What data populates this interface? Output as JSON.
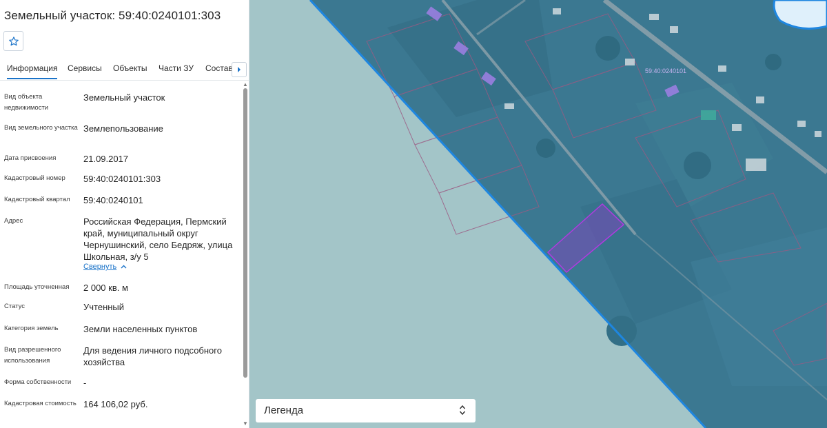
{
  "panel": {
    "title": "Земельный участок: 59:40:0240101:303",
    "favorite_icon": "star-outline-icon",
    "tabs": [
      {
        "label": "Информация",
        "active": true
      },
      {
        "label": "Сервисы",
        "active": false
      },
      {
        "label": "Объекты",
        "active": false
      },
      {
        "label": "Части ЗУ",
        "active": false
      },
      {
        "label": "Состав",
        "active": false
      }
    ],
    "tab_scroll_icon": "caret-right-icon",
    "fields": [
      {
        "label": "Вид объекта недвижимости",
        "value": "Земельный участок"
      },
      {
        "label": "Вид земельного участка",
        "value": "Землепользование"
      },
      {
        "label": "Дата присвоения",
        "value": "21.09.2017"
      },
      {
        "label": "Кадастровый номер",
        "value": "59:40:0240101:303"
      },
      {
        "label": "Кадастровый квартал",
        "value": "59:40:0240101"
      },
      {
        "label": "Адрес",
        "value": "Российская Федерация, Пермский край, муниципальный округ Чернушинский, село Бедряж, улица Школьная, з/у 5"
      },
      {
        "label": "Площадь уточненная",
        "value": "2 000 кв. м"
      },
      {
        "label": "Статус",
        "value": "Учтенный"
      },
      {
        "label": "Категория земель",
        "value": "Земли населенных пунктов"
      },
      {
        "label": "Вид разрешенного использования",
        "value": "Для ведения личного подсобного хозяйства"
      },
      {
        "label": "Форма собственности",
        "value": "-"
      },
      {
        "label": "Кадастровая стоимость",
        "value": "164 106,02 руб."
      }
    ],
    "collapse_link": "Свернуть"
  },
  "map": {
    "quarter_label": "59:40:0240101",
    "legend_label": "Легенда",
    "legend_toggle_icon": "up-down-chevron-icon",
    "colors": {
      "outside_area": "#a3c5c8",
      "imagery": "#3b7891",
      "boundary": "#1e86e0",
      "parcel_highlight": "#8a3fc4",
      "road": "#8fa3ad",
      "accent_link": "#1a73c9"
    }
  }
}
